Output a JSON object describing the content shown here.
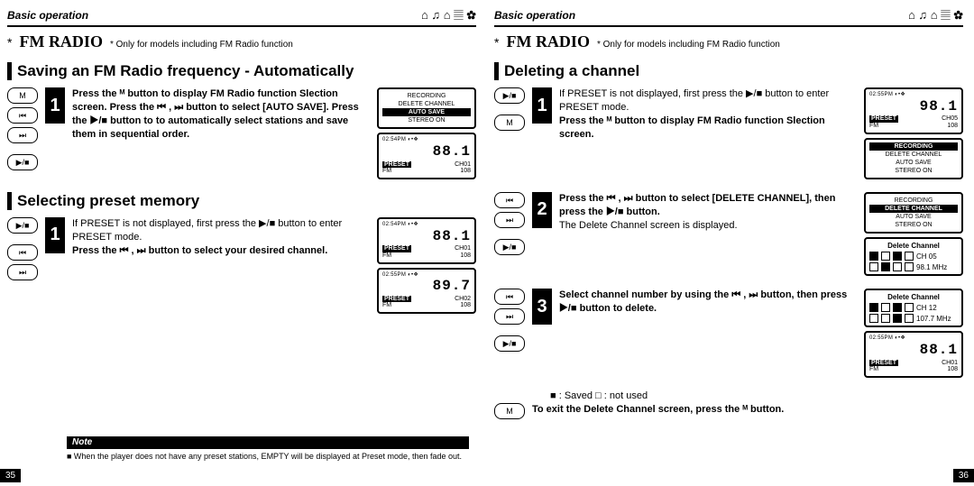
{
  "header": {
    "basic_operation": "Basic operation",
    "icons": "⌂ ♫ ⌂ 𝄚 ✿"
  },
  "title": {
    "star": "*",
    "fmradio": "FM RADIO",
    "only": "* Only for models including FM Radio function"
  },
  "left": {
    "h1": "Saving an FM Radio frequency - Automatically",
    "step1": "Press the  ᴹ  button to display FM Radio function Slection screen.\nPress the  ⏮ , ⏭  button to select [AUTO SAVE].\nPress the  ▶/■  button to to automatically select stations and save them in sequential order.",
    "h2": "Selecting preset memory",
    "s2_top": "If PRESET is not displayed, first press the  ▶/■  button to enter PRESET mode.",
    "s2_bold": "Press the  ⏮ , ⏭  button to select your desired channel.",
    "menu": {
      "r1": "RECORDING",
      "r2": "DELETE CHANNEL",
      "r3": "AUTO SAVE",
      "r4": "STEREO ON"
    },
    "lcd1": {
      "top": "02:54PM ◐•❖",
      "freq": "88.1",
      "preset": "PRESET",
      "ch": "CH01",
      "fm": "FM",
      "num": "108"
    },
    "lcd2": {
      "top": "02:54PM ◐•❖",
      "freq": "88.1",
      "preset": "PRESET",
      "ch": "CH01",
      "fm": "FM",
      "num": "108"
    },
    "lcd3": {
      "top": "02:55PM ◐•❖",
      "freq": "89.7",
      "preset": "PRESET",
      "ch": "CH02",
      "fm": "FM",
      "num": "108"
    },
    "note_label": "Note",
    "note_body": "■ When the player does not have any preset stations, EMPTY will be displayed at Preset mode, then fade out.",
    "pagenum": "35"
  },
  "right": {
    "h1": "Deleting a channel",
    "s1_top": "If PRESET is not displayed, first press the  ▶/■  button to enter PRESET mode.",
    "s1_bold": "Press the  ᴹ  button to display FM Radio function Slection screen.",
    "s2_bold": "Press the  ⏮ , ⏭  button to select [DELETE CHANNEL], then press the  ▶/■  button.",
    "s2_plain": "The Delete Channel screen is displayed.",
    "s3_bold": "Select channel number by using the  ⏮ ,  ⏭  button, then press  ▶/■  button to delete.",
    "legend": "■ : Saved      □ : not used",
    "exit": "To exit the Delete Channel screen, press the  ᴹ  button.",
    "lcd1": {
      "top": "02:55PM ◐•❖",
      "freq": "98.1",
      "preset": "PRESET",
      "ch": "CH05",
      "fm": "FM",
      "num": "108"
    },
    "menuA": {
      "r1": "RECORDING",
      "r2": "DELETE CHANNEL",
      "r3": "AUTO SAVE",
      "r4": "STEREO ON"
    },
    "menuB": {
      "r1": "RECORDING",
      "r2": "DELETE CHANNEL",
      "r3": "AUTO SAVE",
      "r4": "STEREO ON"
    },
    "del1": {
      "title": "Delete Channel",
      "ch": "CH 05",
      "mhz": "98.1 MHz"
    },
    "del2": {
      "title": "Delete Channel",
      "ch": "CH 12",
      "mhz": "107.7 MHz"
    },
    "lcd2": {
      "top": "02:55PM ◐•❖",
      "freq": "88.1",
      "preset": "PRESET",
      "ch": "CH01",
      "fm": "FM",
      "num": "108"
    },
    "pagenum": "36"
  },
  "btn": {
    "m": "M",
    "prev": "⏮",
    "next": "⏭",
    "ps": "▶/■"
  }
}
